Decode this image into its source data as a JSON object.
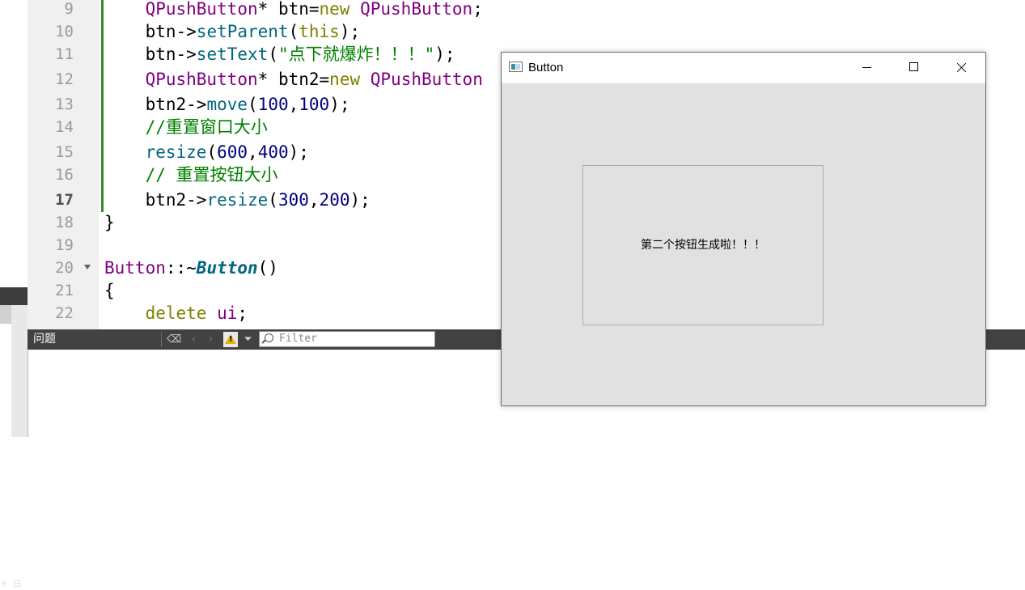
{
  "editor": {
    "lines": [
      {
        "num": "9",
        "tokens": [
          [
            "    ",
            ""
          ],
          [
            "QPushButton",
            "k-type"
          ],
          [
            "* btn=",
            ""
          ],
          [
            "new",
            "k-kw"
          ],
          [
            " ",
            ""
          ],
          [
            "QPushButton",
            "k-type"
          ],
          [
            ";",
            ""
          ]
        ]
      },
      {
        "num": "10",
        "tokens": [
          [
            "    btn->",
            ""
          ],
          [
            "setParent",
            "k-fn"
          ],
          [
            "(",
            ""
          ],
          [
            "this",
            "k-kw"
          ],
          [
            ");",
            ""
          ]
        ]
      },
      {
        "num": "11",
        "tokens": [
          [
            "    btn->",
            ""
          ],
          [
            "setText",
            "k-fn"
          ],
          [
            "(",
            ""
          ],
          [
            "\"点下就爆炸！！！\"",
            "k-str"
          ],
          [
            ");",
            ""
          ]
        ]
      },
      {
        "num": "12",
        "tokens": [
          [
            "    ",
            ""
          ],
          [
            "QPushButton",
            "k-type"
          ],
          [
            "* btn2=",
            ""
          ],
          [
            "new",
            "k-kw"
          ],
          [
            " ",
            ""
          ],
          [
            "QPushButton",
            "k-type"
          ]
        ]
      },
      {
        "num": "13",
        "tokens": [
          [
            "    btn2->",
            ""
          ],
          [
            "move",
            "k-fn"
          ],
          [
            "(",
            ""
          ],
          [
            "100",
            "k-num"
          ],
          [
            ",",
            ""
          ],
          [
            "100",
            "k-num"
          ],
          [
            ");",
            ""
          ]
        ]
      },
      {
        "num": "14",
        "tokens": [
          [
            "    ",
            ""
          ],
          [
            "//重置窗口大小",
            "k-cmt"
          ]
        ]
      },
      {
        "num": "15",
        "tokens": [
          [
            "    ",
            ""
          ],
          [
            "resize",
            "k-fn"
          ],
          [
            "(",
            ""
          ],
          [
            "600",
            "k-num"
          ],
          [
            ",",
            ""
          ],
          [
            "400",
            "k-num"
          ],
          [
            ");",
            ""
          ]
        ]
      },
      {
        "num": "16",
        "tokens": [
          [
            "    ",
            ""
          ],
          [
            "// 重置按钮大小",
            "k-cmt"
          ]
        ]
      },
      {
        "num": "17",
        "current": true,
        "tokens": [
          [
            "    btn2->",
            ""
          ],
          [
            "resize",
            "k-fn"
          ],
          [
            "(",
            ""
          ],
          [
            "300",
            "k-num"
          ],
          [
            ",",
            ""
          ],
          [
            "200",
            "k-num"
          ],
          [
            ");",
            ""
          ]
        ]
      },
      {
        "num": "18",
        "tokens": [
          [
            "}",
            ""
          ]
        ]
      },
      {
        "num": "19",
        "tokens": []
      },
      {
        "num": "20",
        "fold": true,
        "tokens": [
          [
            "Button",
            "k-type"
          ],
          [
            "::~",
            ""
          ],
          [
            "Button",
            "k-fn-bi"
          ],
          [
            "()",
            ""
          ]
        ]
      },
      {
        "num": "21",
        "tokens": [
          [
            "{",
            ""
          ]
        ]
      },
      {
        "num": "22",
        "tokens": [
          [
            "    ",
            ""
          ],
          [
            "delete",
            "k-kw"
          ],
          [
            " ",
            ""
          ],
          [
            "ui",
            "k-type"
          ],
          [
            ";",
            ""
          ]
        ]
      }
    ]
  },
  "issues": {
    "title": "问题",
    "filter_placeholder": "Filter",
    "icons": [
      "clean-icon",
      "back-icon",
      "forward-icon",
      "warning-icon",
      "filter-funnel-icon"
    ]
  },
  "window": {
    "title": "Button",
    "button_label": "第二个按钮生成啦！！！"
  }
}
